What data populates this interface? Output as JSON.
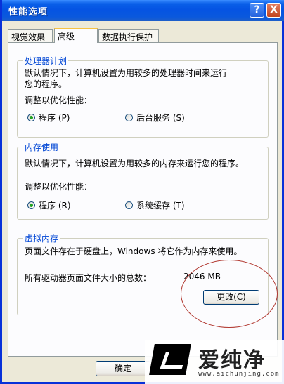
{
  "window": {
    "title": "性能选项",
    "help_glyph": "?",
    "close_glyph": "X"
  },
  "tabs": [
    {
      "label": "视觉效果"
    },
    {
      "label": "高级"
    },
    {
      "label": "数据执行保护"
    }
  ],
  "processor_group": {
    "title": "处理器计划",
    "desc_line1": "默认情况下，计算机设置为用较多的处理器时间来运行",
    "desc_line2": "您的程序。",
    "adjust_label": "调整以优化性能：",
    "option_programs": "程序 (P)",
    "option_background": "后台服务 (S)"
  },
  "memory_group": {
    "title": "内存使用",
    "desc_line1": "默认情况下，计算机设置为用较多的内存来运行您的程序。",
    "adjust_label": "调整以优化性能：",
    "option_programs": "程序 (R)",
    "option_cache": "系统缓存 (T)"
  },
  "virtual_memory_group": {
    "title": "虚拟内存",
    "desc_line1": "页面文件存在于硬盘上，Windows 将它作为内存来使用。",
    "total_label": "所有驱动器页面文件大小的总数：",
    "total_value": "2046 MB",
    "change_button": "更改(C)"
  },
  "footer": {
    "ok_button": "确定"
  },
  "watermark": {
    "main_text": "爱纯净",
    "sub_text": "www.aichunjing.com"
  },
  "colors": {
    "titlebar": "#0A5FE8",
    "group_title": "#0046D5",
    "annotation_circle": "#B23A32",
    "radio_checked": "#21A121"
  }
}
